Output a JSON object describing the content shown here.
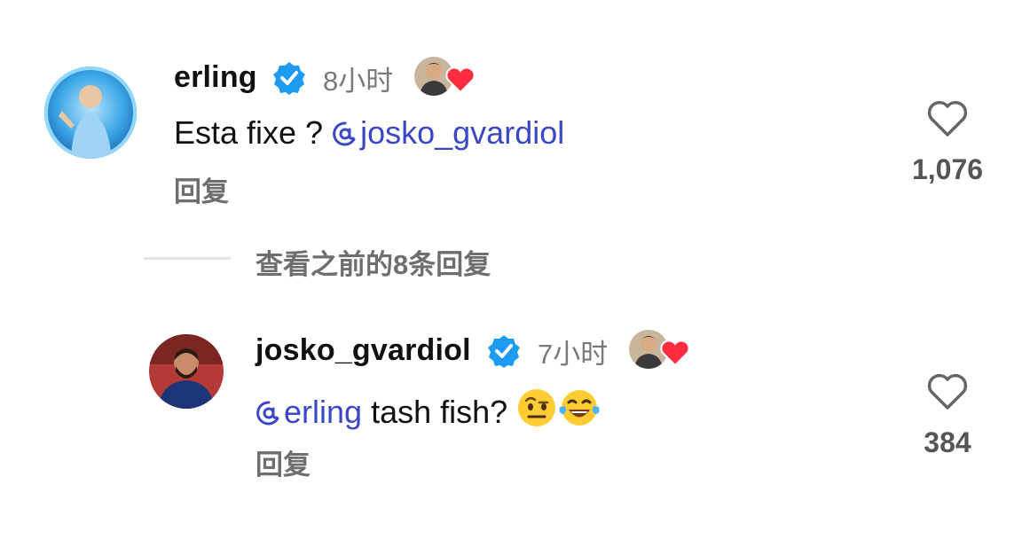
{
  "comments": [
    {
      "username": "erling",
      "time": "8小时",
      "mention_icon": "threads-at-icon",
      "text_mention": "josko_gvardiol",
      "text_before": "Esta fixe ? ",
      "text_after": "",
      "reply_label": "回复",
      "likes": "1,076"
    },
    {
      "username": "josko_gvardiol",
      "time": "7小时",
      "mention_icon": "threads-at-icon",
      "text_mention": "erling",
      "text_before": "",
      "text_after": " tash fish?",
      "emojis": [
        "raised-eyebrow-face",
        "tears-of-joy-face"
      ],
      "reply_label": "回复",
      "likes": "384"
    }
  ],
  "view_more_label": "查看之前的8条回复",
  "colors": {
    "verified": "#1d9bf0",
    "mention": "#3b47c4",
    "heart_red": "#ff2d3f",
    "muted": "#6e6e6e"
  }
}
